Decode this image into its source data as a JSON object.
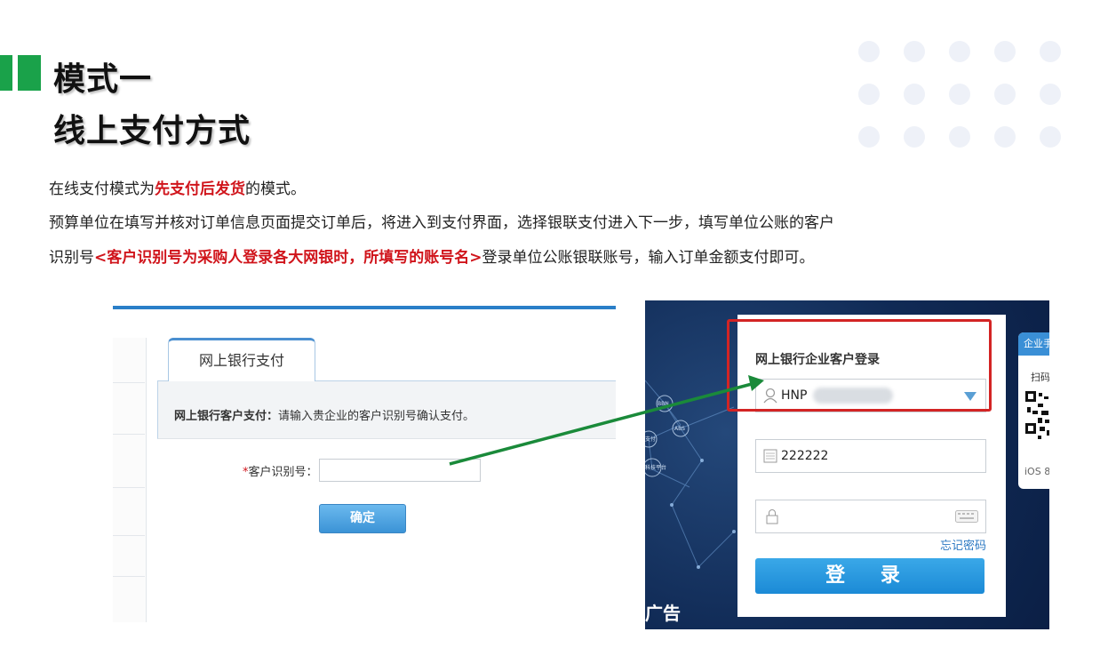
{
  "header": {
    "title_line1": "模式一",
    "title_line2": "线上支付方式",
    "accent_color": "#1aa24a"
  },
  "paragraph": {
    "line1_pre": "在线支付模式为",
    "line1_highlight": "先支付后发货",
    "line1_post": "的模式。",
    "line2": "预算单位在填写并核对订单信息页面提交订单后，将进入到支付界面，选择银联支付进入下一步，填写单位公账的客户",
    "line3_pre": "识别号",
    "line3_highlight": "<客户识别号为采购人登录各大网银时，所填写的账号名>",
    "line3_post": "登录单位公账银联账号，输入订单金额支付即可。",
    "highlight_color": "#d0141b"
  },
  "payment_page": {
    "tab_label": "网上银行支付",
    "info_label": "网上银行客户支付：",
    "info_text": "请输入贵企业的客户识别号确认支付。",
    "required_mark": "*",
    "id_label": "客户识别号：",
    "id_value": "",
    "confirm_button": "确定"
  },
  "bank_login": {
    "title": "网上银行企业客户登录",
    "username_value": "HNP",
    "password_value": "222222",
    "forgot_link": "忘记密码",
    "login_button": "登 录",
    "side_tab": "企业手",
    "side_scan": "扫码",
    "side_ios": "iOS 8",
    "background_ad": "广告",
    "net_labels": [
      "BBN",
      "ABS",
      "支付",
      "科技平台"
    ],
    "icons": [
      "user-icon",
      "keyboard-icon",
      "lock-icon",
      "dropdown-arrow-icon",
      "qr-code-icon"
    ]
  },
  "annotation": {
    "arrow_color": "#1a8a3a",
    "box_color": "#d32424"
  }
}
